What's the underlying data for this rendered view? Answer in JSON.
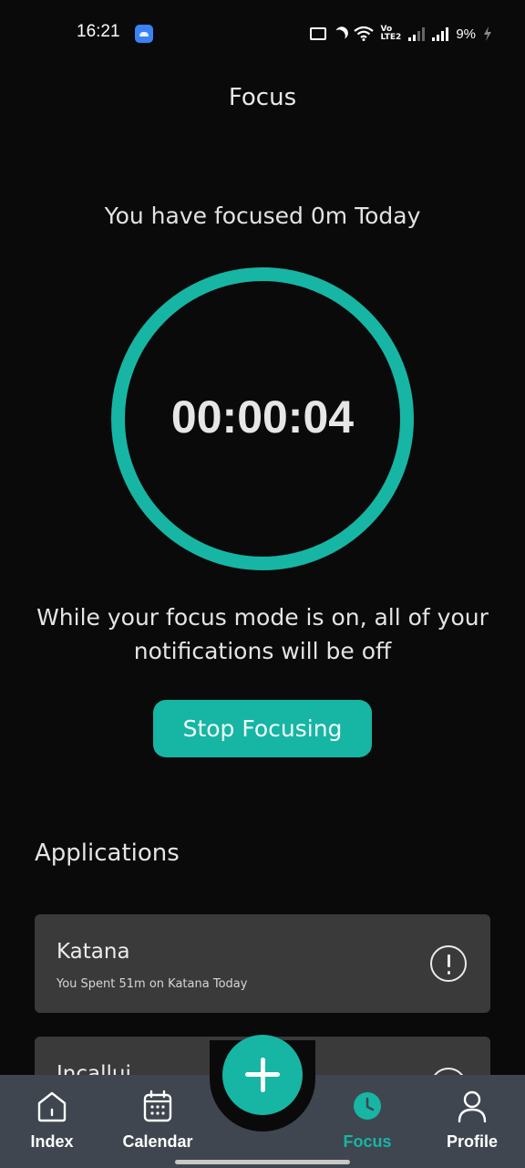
{
  "status_bar": {
    "time": "16:21",
    "battery_text": "9%",
    "volte_top": "Vo",
    "volte_bottom": "LTE2",
    "icons": [
      "screen-record-icon",
      "moon-icon",
      "wifi-icon",
      "volte-icon",
      "signal-icon",
      "signal-icon",
      "battery-charging-icon"
    ]
  },
  "header": {
    "title": "Focus"
  },
  "focus": {
    "summary": "You have focused 0m Today",
    "timer": "00:00:04",
    "note": "While your focus mode is on, all of your notifications will be off",
    "stop_label": "Stop Focusing"
  },
  "applications": {
    "title": "Applications",
    "items": [
      {
        "name": "Katana",
        "subtitle": "You Spent 51m on Katana Today"
      },
      {
        "name": "Incallui",
        "subtitle": ""
      }
    ]
  },
  "nav": {
    "items": [
      {
        "label": "Index",
        "icon": "home-icon"
      },
      {
        "label": "Calendar",
        "icon": "calendar-icon"
      },
      {
        "label": "Focus",
        "icon": "clock-icon",
        "active": true
      },
      {
        "label": "Profile",
        "icon": "user-icon"
      }
    ],
    "fab_icon": "plus-icon"
  },
  "colors": {
    "accent": "#17b5a4",
    "background": "#0a0a0a",
    "card": "#3a3a3a",
    "nav_bar": "#3f4650"
  }
}
